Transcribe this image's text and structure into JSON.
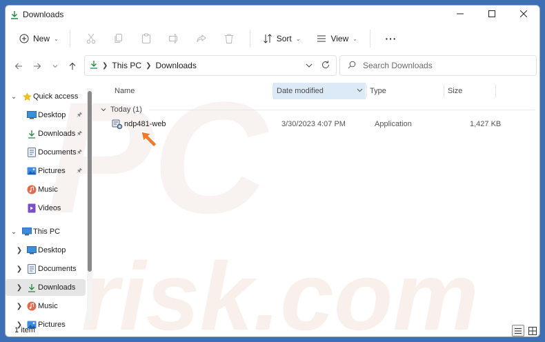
{
  "window": {
    "title": "Downloads",
    "colors": {
      "accent": "#0067c0",
      "selected_column": "#dce9f7",
      "selection": "#e5e5e5",
      "background": "#3c6fb4"
    }
  },
  "toolbar": {
    "new_label": "New",
    "sort_label": "Sort",
    "view_label": "View",
    "icons": [
      "cut-icon",
      "copy-icon",
      "paste-icon",
      "rename-icon",
      "share-icon",
      "delete-icon"
    ]
  },
  "address": {
    "crumbs": [
      "This PC",
      "Downloads"
    ]
  },
  "search": {
    "placeholder": "Search Downloads"
  },
  "nav": {
    "quick_access": {
      "label": "Quick access",
      "items": [
        {
          "label": "Desktop",
          "icon": "desktop-icon",
          "pinned": true
        },
        {
          "label": "Downloads",
          "icon": "downloads-icon",
          "pinned": true
        },
        {
          "label": "Documents",
          "icon": "documents-icon",
          "pinned": true
        },
        {
          "label": "Pictures",
          "icon": "pictures-icon",
          "pinned": true
        },
        {
          "label": "Music",
          "icon": "music-icon",
          "pinned": false
        },
        {
          "label": "Videos",
          "icon": "videos-icon",
          "pinned": false
        }
      ]
    },
    "this_pc": {
      "label": "This PC",
      "items": [
        {
          "label": "Desktop",
          "icon": "desktop-icon"
        },
        {
          "label": "Documents",
          "icon": "documents-icon"
        },
        {
          "label": "Downloads",
          "icon": "downloads-icon",
          "selected": true
        },
        {
          "label": "Music",
          "icon": "music-icon"
        },
        {
          "label": "Pictures",
          "icon": "pictures-icon"
        }
      ]
    }
  },
  "columns": {
    "name": "Name",
    "date_modified": "Date modified",
    "type": "Type",
    "size": "Size",
    "sorted_by": "Date modified"
  },
  "group": {
    "label": "Today (1)"
  },
  "files": [
    {
      "name": "ndp481-web",
      "date": "3/30/2023 4:07 PM",
      "type": "Application",
      "size": "1,427 KB"
    }
  ],
  "status": {
    "item_count": "1 item"
  },
  "watermark": "PC risk.com"
}
